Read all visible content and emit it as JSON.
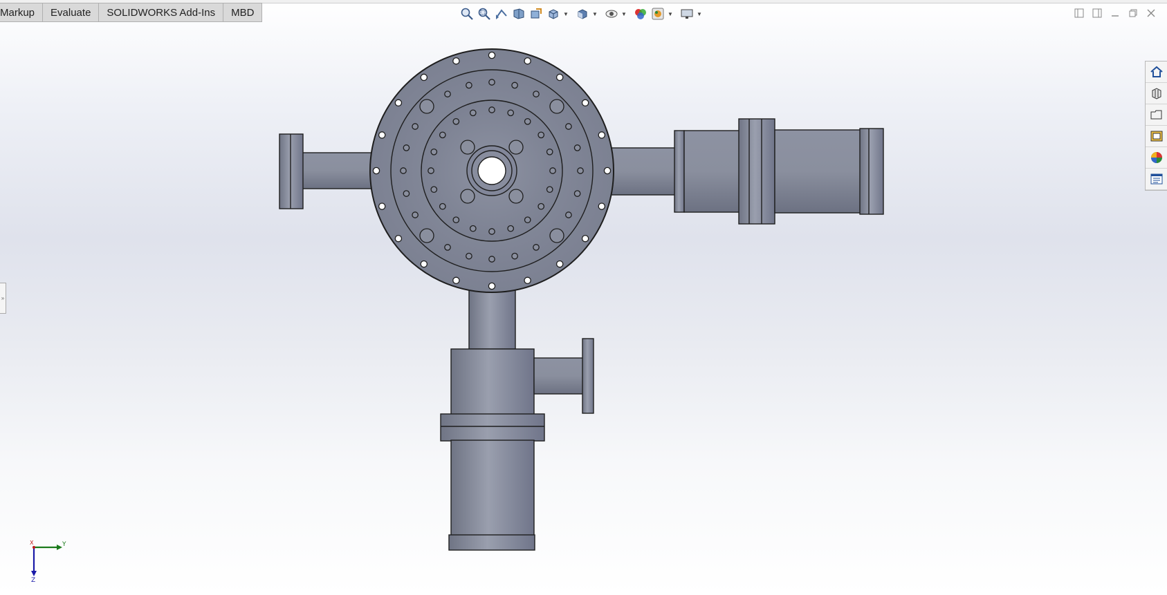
{
  "tabs": [
    "Markup",
    "Evaluate",
    "SOLIDWORKS Add-Ins",
    "MBD"
  ],
  "headsup_icons": [
    "zoom-to-fit-icon",
    "zoom-to-area-icon",
    "previous-view-icon",
    "section-view-icon",
    "dynamic-annotation-views-icon",
    "view-orientation-icon",
    "display-style-icon",
    "hide-show-items-icon",
    "edit-appearance-icon",
    "apply-scene-icon",
    "view-settings-icon"
  ],
  "window_controls": [
    "tile-left-icon",
    "tile-right-icon",
    "minimize-icon",
    "restore-icon",
    "close-icon"
  ],
  "task_pane": [
    "home-icon",
    "design-library-icon",
    "file-explorer-icon",
    "view-palette-icon",
    "appearances-scenes-icon",
    "custom-properties-icon"
  ],
  "triad": {
    "y_label": "Y",
    "z_label": "Z",
    "x_label": "X"
  },
  "colors": {
    "model": "#8a8f9e",
    "model_dark": "#6c7180",
    "outline": "#1e1e1e",
    "triad_y": "#1b7a1b",
    "triad_z": "#1a1aa8",
    "triad_x": "#c01818"
  }
}
